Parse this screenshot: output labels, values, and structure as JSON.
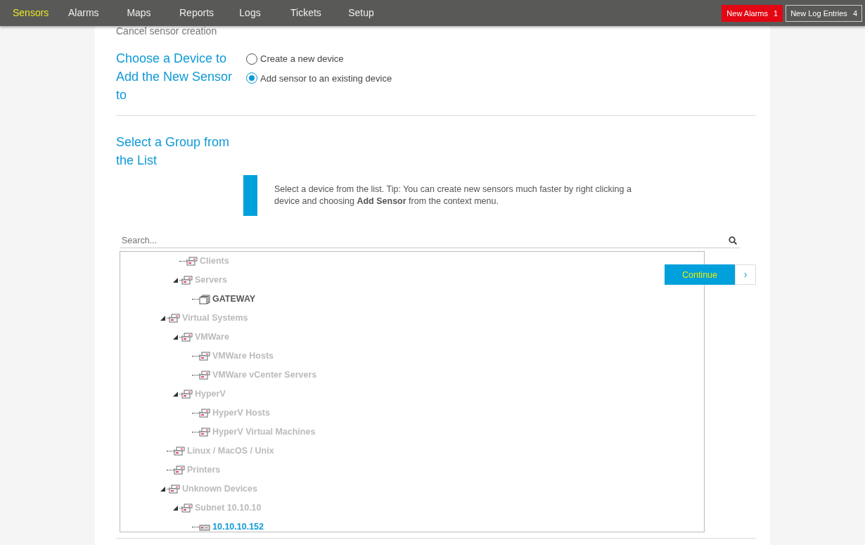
{
  "nav": {
    "items": [
      {
        "label": "Sensors",
        "selected": true
      },
      {
        "label": "Alarms",
        "selected": false
      },
      {
        "label": "Maps",
        "selected": false
      },
      {
        "label": "Reports",
        "selected": false
      },
      {
        "label": "Logs",
        "selected": false
      },
      {
        "label": "Tickets",
        "selected": false
      },
      {
        "label": "Setup",
        "selected": false
      }
    ],
    "alerts": [
      {
        "kind": "alarm",
        "label": "New Alarms",
        "count": "1"
      },
      {
        "kind": "log",
        "label": "New Log Entries",
        "count": "4"
      }
    ]
  },
  "back_link": "Cancel sensor creation",
  "device_section": {
    "heading": "Choose a Device to Add the New Sensor to",
    "options": [
      {
        "label": "Create a new device",
        "selected": false
      },
      {
        "label": "Add sensor to an existing device",
        "selected": true
      }
    ]
  },
  "group_section": {
    "heading": "Select a Group from the List",
    "tip": "Select a device from the list. Tip: You can create new sensors much faster by right clicking a device and choosing **Add Sensor** from the context menu.",
    "search": {
      "placeholder": "Search..."
    },
    "tree": {
      "scrolled_branch_children": [
        {
          "label": "Clients",
          "kind": "group",
          "expanded": false,
          "selected": false
        },
        {
          "label": "Servers",
          "kind": "group",
          "expanded": true,
          "selected": false,
          "children": [
            {
              "label": "GATEWAY",
              "kind": "probe",
              "selected": false
            }
          ]
        }
      ],
      "items": [
        {
          "label": "Virtual Systems",
          "kind": "group",
          "expanded": true,
          "selected": false,
          "children": [
            {
              "label": "VMWare",
              "kind": "group",
              "expanded": true,
              "selected": false,
              "children": [
                {
                  "label": "VMWare Hosts",
                  "kind": "group",
                  "expanded": false,
                  "selected": false
                },
                {
                  "label": "VMWare vCenter Servers",
                  "kind": "group",
                  "expanded": false,
                  "selected": false
                }
              ]
            },
            {
              "label": "HyperV",
              "kind": "group",
              "expanded": true,
              "selected": false,
              "children": [
                {
                  "label": "HyperV Hosts",
                  "kind": "group",
                  "expanded": false,
                  "selected": false
                },
                {
                  "label": "HyperV Virtual Machines",
                  "kind": "group",
                  "expanded": false,
                  "selected": false
                }
              ]
            }
          ]
        },
        {
          "label": "Linux / MacOS / Unix",
          "kind": "group",
          "expanded": false,
          "selected": false
        },
        {
          "label": "Printers",
          "kind": "group",
          "expanded": false,
          "selected": false
        },
        {
          "label": "Unknown Devices",
          "kind": "group",
          "expanded": true,
          "selected": false,
          "children": [
            {
              "label": "Subnet 10.10.10",
              "kind": "group",
              "expanded": true,
              "selected": false,
              "children": [
                {
                  "label": "10.10.10.152",
                  "kind": "device",
                  "selected": true
                }
              ]
            }
          ]
        }
      ]
    }
  },
  "continue_button": {
    "label": "Continue",
    "arrow": "›"
  }
}
